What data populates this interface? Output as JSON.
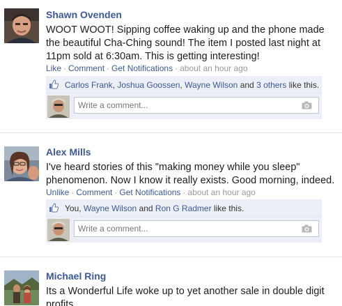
{
  "colors": {
    "link": "#3b5998",
    "ufi_background": "#eceff5",
    "muted": "#999999"
  },
  "posts": [
    {
      "author": "Shawn Ovenden",
      "message": "WOOT WOOT! Sipping coffee waking up and the phone made the beautiful Cha-Ching sound! The item I posted last night at 11pm sold at 6:30am. This is getting interesting!",
      "actions": {
        "like": "Like",
        "comment": "Comment",
        "notify": "Get Notifications",
        "time": "about an hour ago",
        "sep": "·"
      },
      "likes": {
        "names": [
          "Carlos Frank",
          "Joshua Goossen",
          "Wayne Wilson"
        ],
        "and": "and",
        "others": "3 others",
        "suffix": "like this."
      },
      "comment_placeholder": "Write a comment...",
      "icons": {
        "like": "thumbs-up-icon",
        "camera": "camera-icon"
      }
    },
    {
      "author": "Alex Mills",
      "message": "I've heard stories of this \"making money while you sleep\" phenomenon. Now I know it really exists. Good morning, indeed.",
      "actions": {
        "like": "Unlike",
        "comment": "Comment",
        "notify": "Get Notifications",
        "time": "about an hour ago",
        "sep": "·"
      },
      "likes": {
        "you": "You,",
        "names": [
          "Wayne Wilson",
          "Ron G Radmer"
        ],
        "and": "and",
        "suffix": "like this."
      },
      "comment_placeholder": "Write a comment...",
      "icons": {
        "like": "thumbs-up-icon",
        "camera": "camera-icon"
      }
    },
    {
      "author": "Michael Ring",
      "message": "Its a Wonderful Life woke up to yet another sale in double digit profits."
    }
  ]
}
